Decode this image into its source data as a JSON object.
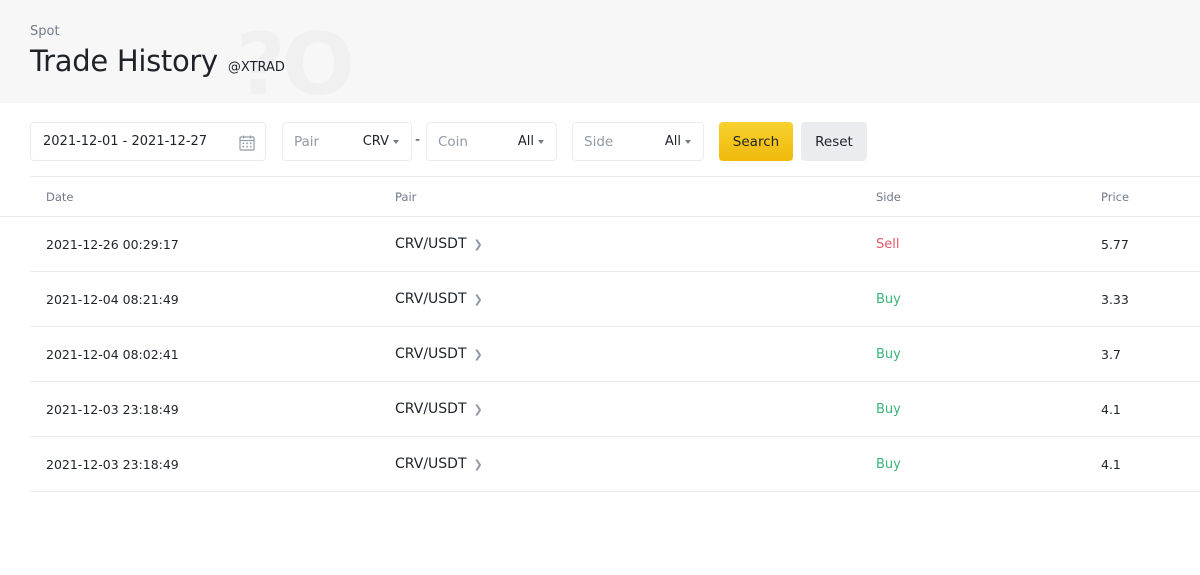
{
  "header": {
    "breadcrumb": "Spot",
    "title": "Trade History",
    "handle": "@XTRAD"
  },
  "filters": {
    "date_range": "2021-12-01 - 2021-12-27",
    "pair": {
      "label": "Pair",
      "value": "CRV"
    },
    "separator": "-",
    "coin": {
      "label": "Coin",
      "value": "All"
    },
    "side": {
      "label": "Side",
      "value": "All"
    },
    "search_label": "Search",
    "reset_label": "Reset"
  },
  "table": {
    "columns": [
      "Date",
      "Pair",
      "Side",
      "Price"
    ],
    "rows": [
      {
        "date": "2021-12-26 00:29:17",
        "pair": "CRV/USDT",
        "side": "Sell",
        "price": "5.77"
      },
      {
        "date": "2021-12-04 08:21:49",
        "pair": "CRV/USDT",
        "side": "Buy",
        "price": "3.33"
      },
      {
        "date": "2021-12-04 08:02:41",
        "pair": "CRV/USDT",
        "side": "Buy",
        "price": "3.7"
      },
      {
        "date": "2021-12-03 23:18:49",
        "pair": "CRV/USDT",
        "side": "Buy",
        "price": "4.1"
      },
      {
        "date": "2021-12-03 23:18:49",
        "pair": "CRV/USDT",
        "side": "Buy",
        "price": "4.1"
      }
    ]
  },
  "colors": {
    "accent": "#f0b90b",
    "sell": "#e05a68",
    "buy": "#3bb478",
    "header_bg": "#f7f7f7",
    "border": "#eaecef"
  },
  "icons": {
    "date_picker": "calendar-icon",
    "dropdown": "caret-down-icon",
    "pair_link": "chevron-right-icon"
  }
}
